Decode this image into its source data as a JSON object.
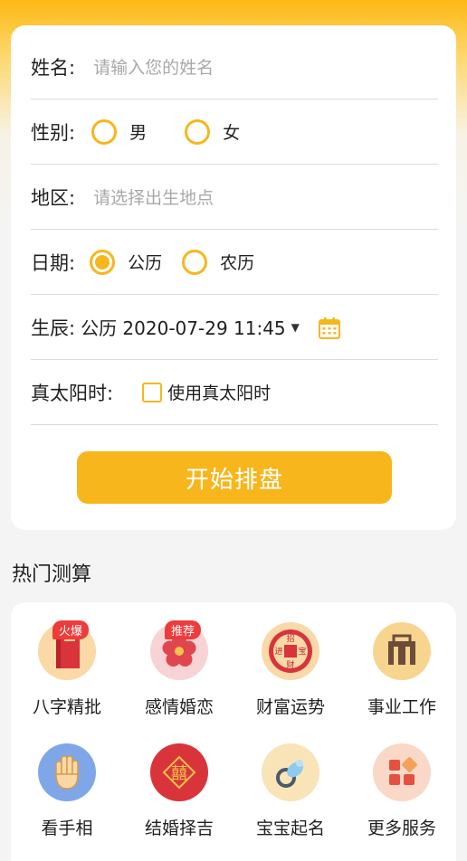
{
  "form": {
    "name": {
      "label": "姓名:",
      "placeholder": "请输入您的姓名"
    },
    "gender": {
      "label": "性别:",
      "options": [
        "男",
        "女"
      ]
    },
    "region": {
      "label": "地区:",
      "placeholder": "请选择出生地点"
    },
    "date": {
      "label": "日期:",
      "options": [
        "公历",
        "农历"
      ],
      "selected": "公历"
    },
    "birth": {
      "label": "生辰:",
      "value": "公历 2020-07-29 11:45"
    },
    "solar": {
      "label": "真太阳时:",
      "checkbox_label": "使用真太阳时",
      "checked": false
    },
    "submit_label": "开始排盘"
  },
  "hot": {
    "title": "热门测算",
    "items": [
      {
        "name": "八字精批",
        "badge": "火爆",
        "icon": "book-icon"
      },
      {
        "name": "感情婚恋",
        "badge": "推荐",
        "icon": "plum-blossom-icon"
      },
      {
        "name": "财富运势",
        "badge": "",
        "icon": "coin-icon",
        "coin_chars": [
          "招",
          "进",
          "宝",
          "财"
        ]
      },
      {
        "name": "事业工作",
        "badge": "",
        "icon": "briefcase-icon"
      },
      {
        "name": "看手相",
        "badge": "",
        "icon": "palm-icon"
      },
      {
        "name": "结婚择吉",
        "badge": "",
        "icon": "double-happiness-icon",
        "glyph": "囍"
      },
      {
        "name": "宝宝起名",
        "badge": "",
        "icon": "pacifier-icon"
      },
      {
        "name": "更多服务",
        "badge": "",
        "icon": "more-grid-icon"
      }
    ]
  },
  "colors": {
    "accent": "#F8B61D",
    "badge": "#EE3B3B",
    "background": "#F4F4F4"
  }
}
